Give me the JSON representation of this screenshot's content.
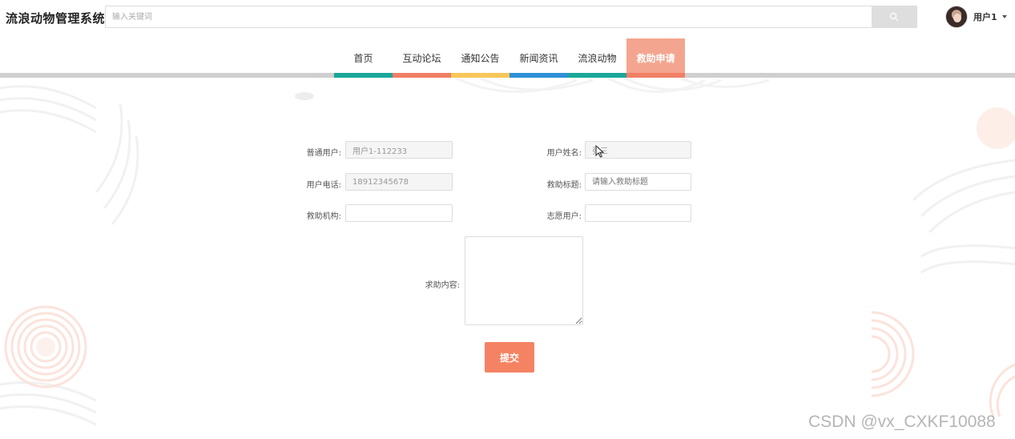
{
  "header": {
    "site_title": "流浪动物管理系统",
    "search_placeholder": "输入关键词",
    "search_icon": "search-icon",
    "user_name": "用户1"
  },
  "nav": {
    "items": [
      {
        "label": "首页",
        "bar_color": "#1aa89a"
      },
      {
        "label": "互动论坛",
        "bar_color": "#f07f65"
      },
      {
        "label": "通知公告",
        "bar_color": "#f8c75a"
      },
      {
        "label": "新闻资讯",
        "bar_color": "#2f8fd8"
      },
      {
        "label": "流浪动物",
        "bar_color": "#1aa89a"
      },
      {
        "label": "救助申请",
        "bar_color": "#f07f65"
      }
    ],
    "active_index": 5
  },
  "form": {
    "user_account_label": "普通用户:",
    "user_account_value": "用户1-112233",
    "user_name_label": "用户姓名:",
    "user_name_value": "张三",
    "phone_label": "用户电话:",
    "phone_value": "18912345678",
    "rescue_title_label": "救助标题:",
    "rescue_title_placeholder": "请输入救助标题",
    "rescue_org_label": "救助机构:",
    "rescue_org_value": "",
    "volunteer_label": "志愿用户:",
    "volunteer_value": "",
    "content_label": "求助内容:",
    "content_value": "",
    "submit_label": "提交"
  },
  "watermark": "CSDN @vx_CXKF10088",
  "colors": {
    "accent": "#f58363",
    "active_tab": "#f4a58f"
  }
}
